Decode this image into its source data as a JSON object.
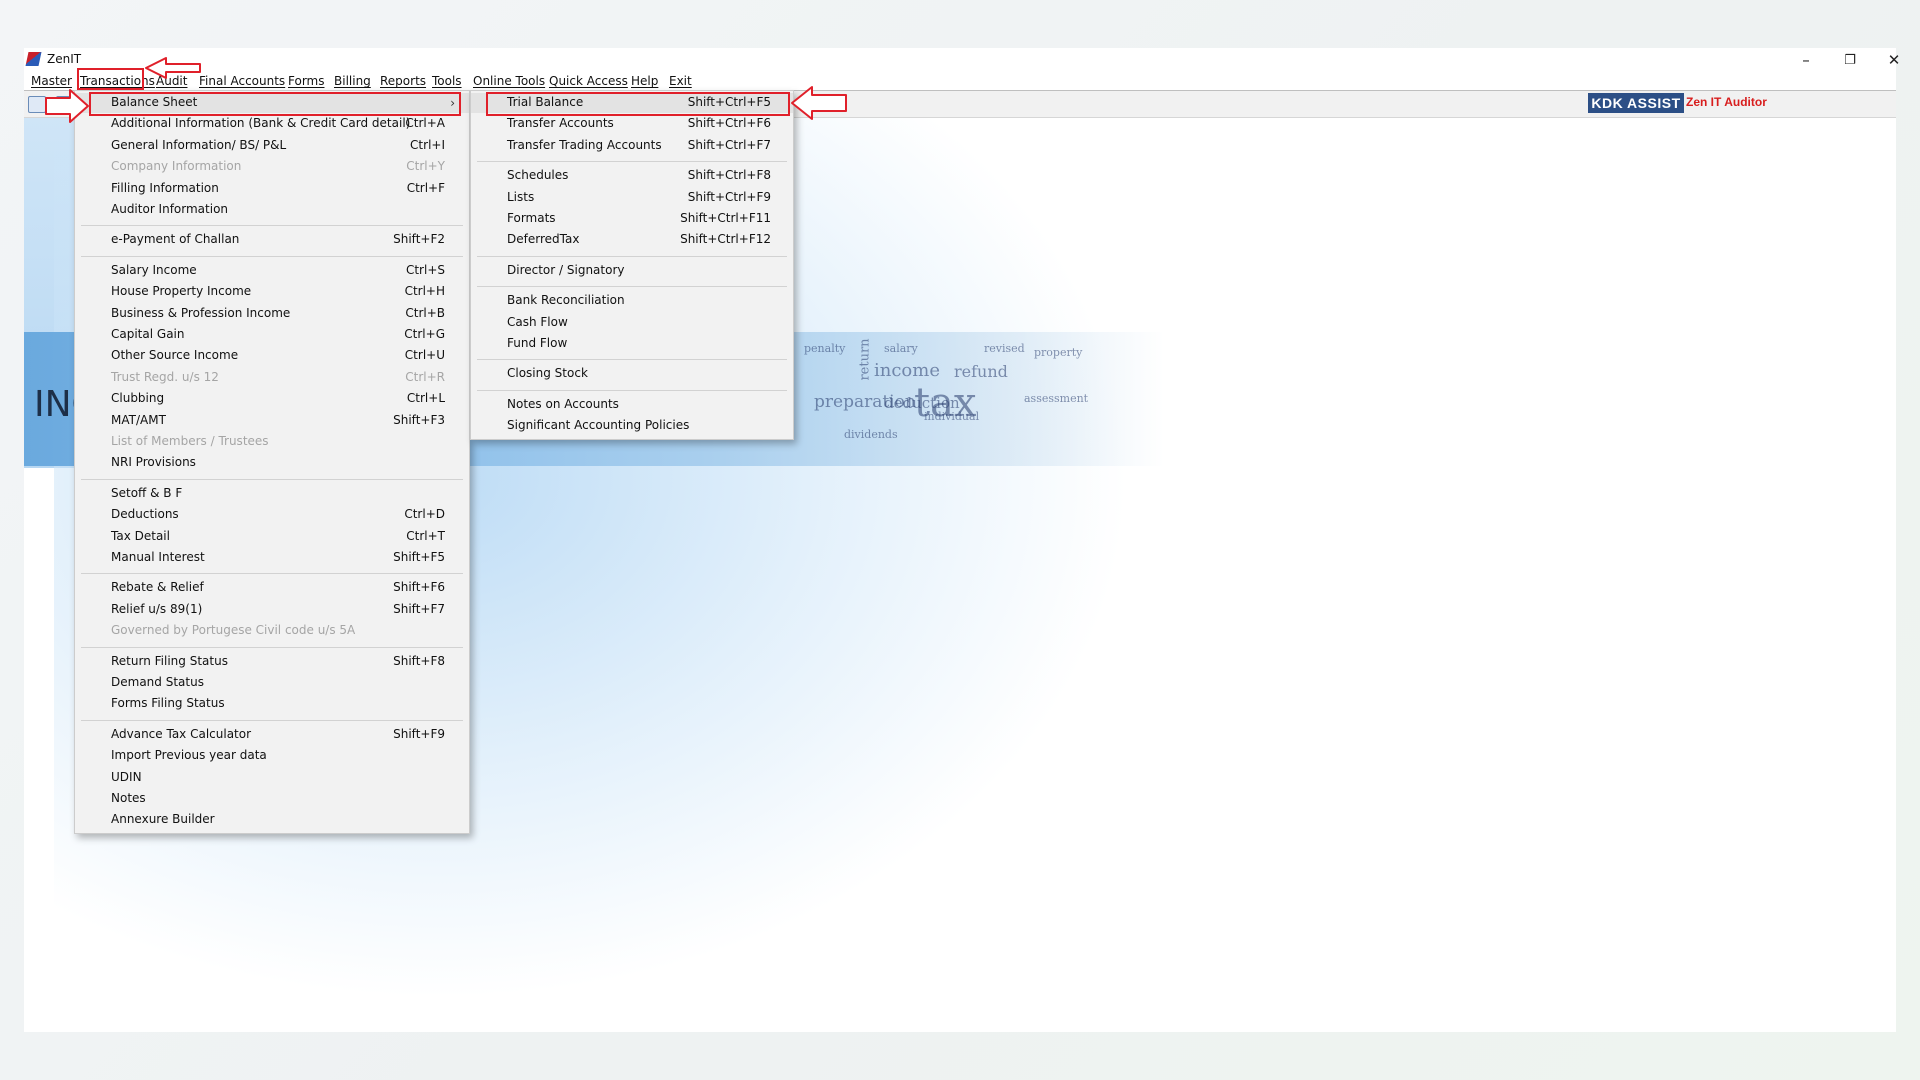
{
  "window": {
    "title": "ZenIT",
    "controls": {
      "minimize": "–",
      "restore": "❐",
      "close": "✕"
    }
  },
  "menubar": {
    "items": [
      "Master",
      "Transactions",
      "Audit",
      "Final Accounts",
      "Forms",
      "Billing",
      "Reports",
      "Tools",
      "Online Tools",
      "Quick Access",
      "Help",
      "Exit"
    ]
  },
  "toolbar": {
    "badge": "KDK ASSIST",
    "badge_sub": "Zen IT Auditor"
  },
  "banner": {
    "text": "INC",
    "words": [
      "return",
      "income",
      "refund",
      "preparation",
      "deduction",
      "tax",
      "property",
      "revised",
      "individual",
      "salary",
      "penalty",
      "assessment",
      "dividends"
    ]
  },
  "transactions_menu": {
    "items": [
      {
        "label": "Balance Sheet",
        "shortcut": "",
        "submenu": true,
        "disabled": false,
        "highlight": true
      },
      {
        "label": "Additional Information (Bank & Credit Card detail)",
        "shortcut": "Ctrl+A",
        "disabled": false
      },
      {
        "label": "General Information/ BS/ P&L",
        "shortcut": "Ctrl+I",
        "disabled": false
      },
      {
        "label": "Company Information",
        "shortcut": "Ctrl+Y",
        "disabled": true
      },
      {
        "label": "Filling Information",
        "shortcut": "Ctrl+F",
        "disabled": false
      },
      {
        "label": "Auditor Information",
        "shortcut": "",
        "disabled": false
      },
      {
        "separator": true
      },
      {
        "label": "e-Payment of Challan",
        "shortcut": "Shift+F2",
        "disabled": false
      },
      {
        "separator": true
      },
      {
        "label": "Salary Income",
        "shortcut": "Ctrl+S",
        "disabled": false
      },
      {
        "label": "House Property Income",
        "shortcut": "Ctrl+H",
        "disabled": false
      },
      {
        "label": "Business & Profession Income",
        "shortcut": "Ctrl+B",
        "disabled": false
      },
      {
        "label": "Capital Gain",
        "shortcut": "Ctrl+G",
        "disabled": false
      },
      {
        "label": "Other Source Income",
        "shortcut": "Ctrl+U",
        "disabled": false
      },
      {
        "label": "Trust Regd. u/s 12",
        "shortcut": "Ctrl+R",
        "disabled": true
      },
      {
        "label": "Clubbing",
        "shortcut": "Ctrl+L",
        "disabled": false
      },
      {
        "label": "MAT/AMT",
        "shortcut": "Shift+F3",
        "disabled": false
      },
      {
        "label": "List of Members / Trustees",
        "shortcut": "",
        "disabled": true
      },
      {
        "label": "NRI Provisions",
        "shortcut": "",
        "disabled": false
      },
      {
        "separator": true
      },
      {
        "label": "Setoff & B F",
        "shortcut": "",
        "disabled": false
      },
      {
        "label": "Deductions",
        "shortcut": "Ctrl+D",
        "disabled": false
      },
      {
        "label": "Tax Detail",
        "shortcut": "Ctrl+T",
        "disabled": false
      },
      {
        "label": "Manual Interest",
        "shortcut": "Shift+F5",
        "disabled": false
      },
      {
        "separator": true
      },
      {
        "label": "Rebate & Relief",
        "shortcut": "Shift+F6",
        "disabled": false
      },
      {
        "label": "Relief u/s 89(1)",
        "shortcut": "Shift+F7",
        "disabled": false
      },
      {
        "label": "Governed by Portugese Civil code u/s 5A",
        "shortcut": "",
        "disabled": true
      },
      {
        "separator": true
      },
      {
        "label": "Return Filing Status",
        "shortcut": "Shift+F8",
        "disabled": false
      },
      {
        "label": "Demand Status",
        "shortcut": "",
        "disabled": false
      },
      {
        "label": "Forms Filing Status",
        "shortcut": "",
        "disabled": false
      },
      {
        "separator": true
      },
      {
        "label": "Advance Tax Calculator",
        "shortcut": "Shift+F9",
        "disabled": false
      },
      {
        "label": "Import Previous year data",
        "shortcut": "",
        "disabled": false
      },
      {
        "label": "UDIN",
        "shortcut": "",
        "disabled": false
      },
      {
        "label": "Notes",
        "shortcut": "",
        "disabled": false
      },
      {
        "label": "Annexure Builder",
        "shortcut": "",
        "disabled": false
      }
    ]
  },
  "balance_sheet_submenu": {
    "items": [
      {
        "label": "Trial Balance",
        "shortcut": "Shift+Ctrl+F5",
        "highlight": true
      },
      {
        "label": "Transfer Accounts",
        "shortcut": "Shift+Ctrl+F6"
      },
      {
        "label": "Transfer Trading Accounts",
        "shortcut": "Shift+Ctrl+F7"
      },
      {
        "separator": true
      },
      {
        "label": "Schedules",
        "shortcut": "Shift+Ctrl+F8"
      },
      {
        "label": "Lists",
        "shortcut": "Shift+Ctrl+F9"
      },
      {
        "label": "Formats",
        "shortcut": "Shift+Ctrl+F11"
      },
      {
        "label": "DeferredTax",
        "shortcut": "Shift+Ctrl+F12"
      },
      {
        "separator": true
      },
      {
        "label": "Director / Signatory",
        "shortcut": ""
      },
      {
        "separator": true
      },
      {
        "label": "Bank Reconciliation",
        "shortcut": ""
      },
      {
        "label": "Cash Flow",
        "shortcut": ""
      },
      {
        "label": "Fund Flow",
        "shortcut": ""
      },
      {
        "separator": true
      },
      {
        "label": "Closing Stock",
        "shortcut": ""
      },
      {
        "separator": true
      },
      {
        "label": "Notes on Accounts",
        "shortcut": ""
      },
      {
        "label": "Significant Accounting Policies",
        "shortcut": ""
      }
    ]
  },
  "colors": {
    "annotation": "#e0202a",
    "badge_bg": "#2c4f86",
    "badge_sub": "#d81e1e"
  }
}
